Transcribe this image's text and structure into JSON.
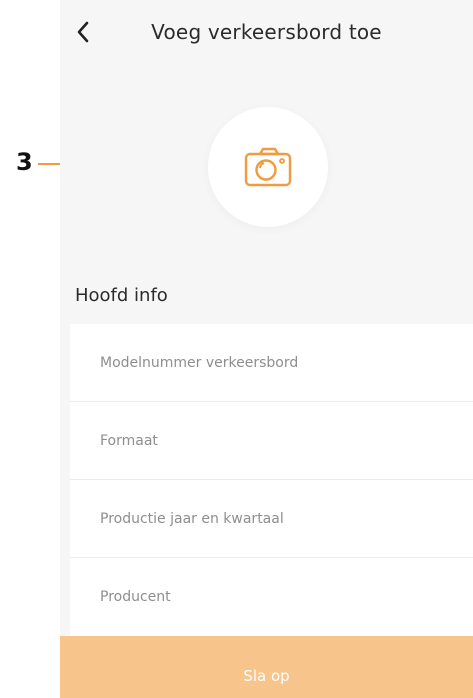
{
  "header": {
    "title": "Voeg verkeersbord toe",
    "back_icon": "chevron-left-icon"
  },
  "photo": {
    "icon": "camera-icon",
    "accent_color": "#f29a3e"
  },
  "section": {
    "title": "Hoofd info"
  },
  "form": {
    "fields": [
      {
        "placeholder": "Modelnummer verkeersbord",
        "value": ""
      },
      {
        "placeholder": "Formaat",
        "value": ""
      },
      {
        "placeholder": "Productie jaar en kwartaal",
        "value": ""
      },
      {
        "placeholder": "Producent",
        "value": ""
      }
    ]
  },
  "footer": {
    "save_label": "Sla op",
    "save_color": "#f7c48c"
  },
  "annotation": {
    "number": "3",
    "arrow_color": "#f29a3e"
  }
}
